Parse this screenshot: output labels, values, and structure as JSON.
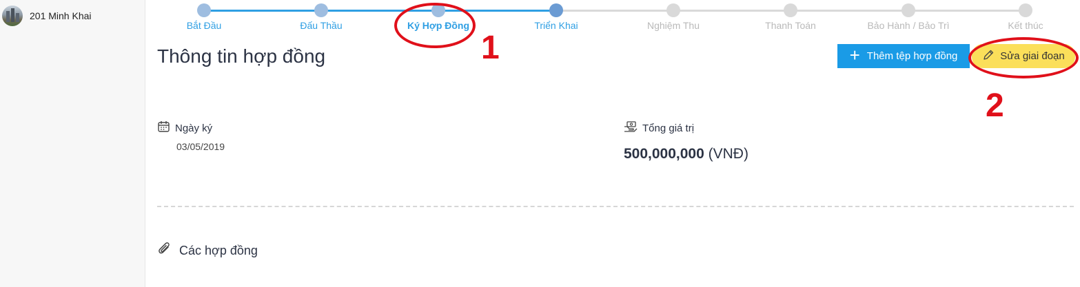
{
  "sidebar": {
    "project_name": "201 Minh Khai"
  },
  "steps": [
    {
      "label": "Bắt Đầu",
      "state": "done"
    },
    {
      "label": "Đấu Thầu",
      "state": "done"
    },
    {
      "label": "Ký Hợp Đồng",
      "state": "active"
    },
    {
      "label": "Triển Khai",
      "state": "current"
    },
    {
      "label": "Nghiệm Thu",
      "state": "todo"
    },
    {
      "label": "Thanh Toán",
      "state": "todo"
    },
    {
      "label": "Bảo Hành / Bảo Trì",
      "state": "todo"
    },
    {
      "label": "Kết thúc",
      "state": "todo"
    }
  ],
  "annotations": {
    "one": "1",
    "two": "2"
  },
  "main": {
    "title": "Thông tin hợp đồng",
    "add_file_label": "Thêm tệp hợp đồng",
    "edit_stage_label": "Sửa giai đoạn",
    "sign_date_label": "Ngày ký",
    "sign_date_value": "03/05/2019",
    "total_value_label": "Tổng giá trị",
    "total_value_amount": "500,000,000",
    "total_value_unit": "(VNĐ)",
    "contracts_label": "Các hợp đồng"
  },
  "colors": {
    "accent": "#1a9be6",
    "edit_button": "#fbdf5a",
    "annotation": "#e0101a",
    "step_done": "#9ebde0",
    "step_todo": "#d9d9d9"
  },
  "icons": [
    "calendar-icon",
    "money-hand-icon",
    "plus-icon",
    "pencil-icon",
    "paperclip-icon"
  ]
}
